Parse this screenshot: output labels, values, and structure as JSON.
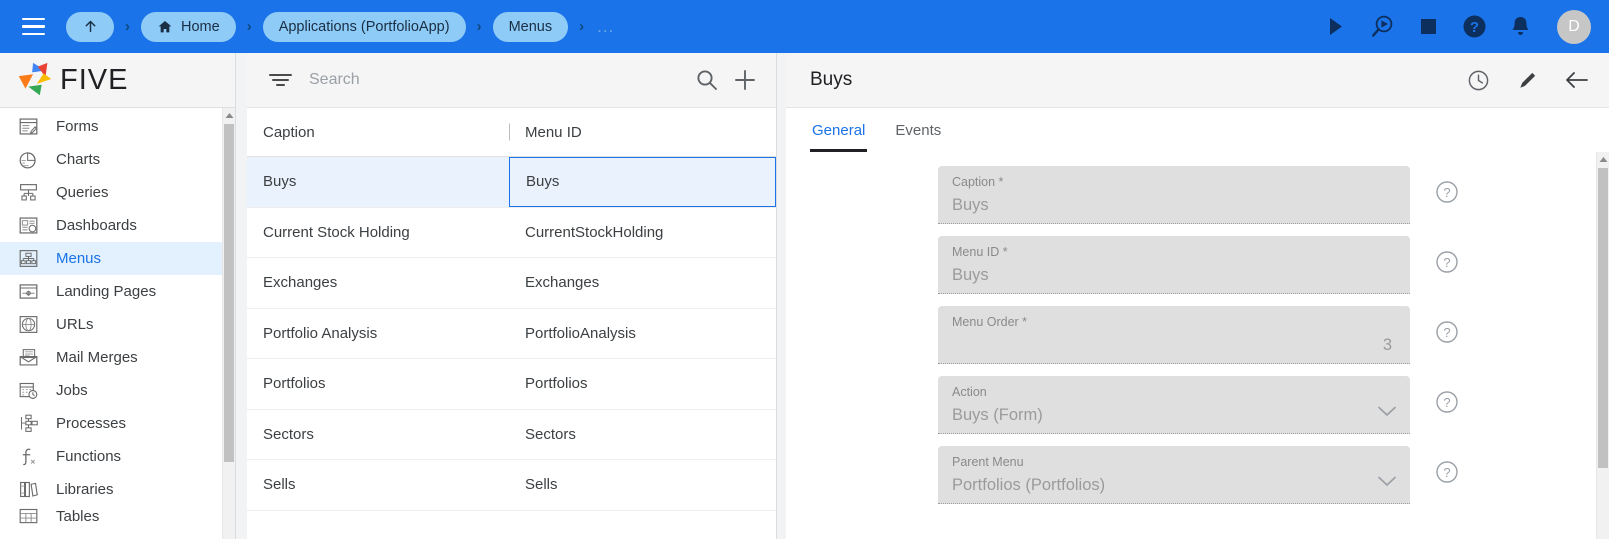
{
  "topbar": {
    "menu_icon": "hamburger-icon",
    "up_button": {
      "icon": "arrow-up-icon",
      "label": ""
    },
    "breadcrumbs": [
      {
        "label": "Home",
        "icon": "home-icon"
      },
      {
        "label": "Applications (PortfolioApp)",
        "icon": ""
      },
      {
        "label": "Menus",
        "icon": ""
      }
    ],
    "overflow": "...",
    "actions": [
      {
        "name": "run-icon",
        "title": "Run"
      },
      {
        "name": "debug-icon",
        "title": "Debug"
      },
      {
        "name": "stop-icon",
        "title": "Stop"
      },
      {
        "name": "help-icon",
        "title": "Help"
      },
      {
        "name": "notifications-bell-icon",
        "title": "Notifications"
      }
    ],
    "avatar_initial": "D",
    "bg_color": "#1a73e8",
    "pill_color": "#8ecbf7"
  },
  "sidebar": {
    "brand": "FIVE",
    "items": [
      {
        "label": "Forms",
        "icon": "forms-icon",
        "active": false
      },
      {
        "label": "Charts",
        "icon": "charts-icon",
        "active": false
      },
      {
        "label": "Queries",
        "icon": "queries-icon",
        "active": false
      },
      {
        "label": "Dashboards",
        "icon": "dashboards-icon",
        "active": false
      },
      {
        "label": "Menus",
        "icon": "menus-icon",
        "active": true
      },
      {
        "label": "Landing Pages",
        "icon": "landing-pages-icon",
        "active": false
      },
      {
        "label": "URLs",
        "icon": "urls-icon",
        "active": false
      },
      {
        "label": "Mail Merges",
        "icon": "mail-merges-icon",
        "active": false
      },
      {
        "label": "Jobs",
        "icon": "jobs-icon",
        "active": false
      },
      {
        "label": "Processes",
        "icon": "processes-icon",
        "active": false
      },
      {
        "label": "Functions",
        "icon": "functions-icon",
        "active": false
      },
      {
        "label": "Libraries",
        "icon": "libraries-icon",
        "active": false
      },
      {
        "label": "Tables",
        "icon": "tables-icon",
        "active": false
      }
    ],
    "active_color": "#1a73e8"
  },
  "list_panel": {
    "search": {
      "placeholder": "Search",
      "value": ""
    },
    "filter_icon": "filter-icon",
    "search_icon": "search-icon",
    "add_icon": "add-plus-icon",
    "columns": [
      "Caption",
      "Menu ID"
    ],
    "rows": [
      {
        "caption": "Buys",
        "menu_id": "Buys",
        "selected": true
      },
      {
        "caption": "Current Stock Holding",
        "menu_id": "CurrentStockHolding",
        "selected": false
      },
      {
        "caption": "Exchanges",
        "menu_id": "Exchanges",
        "selected": false
      },
      {
        "caption": "Portfolio Analysis",
        "menu_id": "PortfolioAnalysis",
        "selected": false
      },
      {
        "caption": "Portfolios",
        "menu_id": "Portfolios",
        "selected": false
      },
      {
        "caption": "Sectors",
        "menu_id": "Sectors",
        "selected": false
      },
      {
        "caption": "Sells",
        "menu_id": "Sells",
        "selected": false
      }
    ],
    "selection_color": "#1a73e8"
  },
  "detail_panel": {
    "title": "Buys",
    "header_actions": [
      {
        "name": "history-clock-icon",
        "title": "History"
      },
      {
        "name": "edit-pencil-icon",
        "title": "Edit"
      },
      {
        "name": "back-arrow-icon",
        "title": "Back"
      }
    ],
    "tabs": [
      {
        "label": "General",
        "active": true
      },
      {
        "label": "Events",
        "active": false
      }
    ],
    "fields": [
      {
        "label": "Caption *",
        "value": "Buys",
        "type": "text",
        "align": "left",
        "help": true
      },
      {
        "label": "Menu ID *",
        "value": "Buys",
        "type": "text",
        "align": "left",
        "help": true
      },
      {
        "label": "Menu Order *",
        "value": "3",
        "type": "number",
        "align": "right",
        "help": true
      },
      {
        "label": "Action",
        "value": "Buys (Form)",
        "type": "select",
        "align": "left",
        "help": true
      },
      {
        "label": "Parent Menu",
        "value": "Portfolios (Portfolios)",
        "type": "select",
        "align": "left",
        "help": true
      }
    ],
    "help_icon": "help-circle-icon",
    "chevron_icon": "chevron-down-icon"
  }
}
